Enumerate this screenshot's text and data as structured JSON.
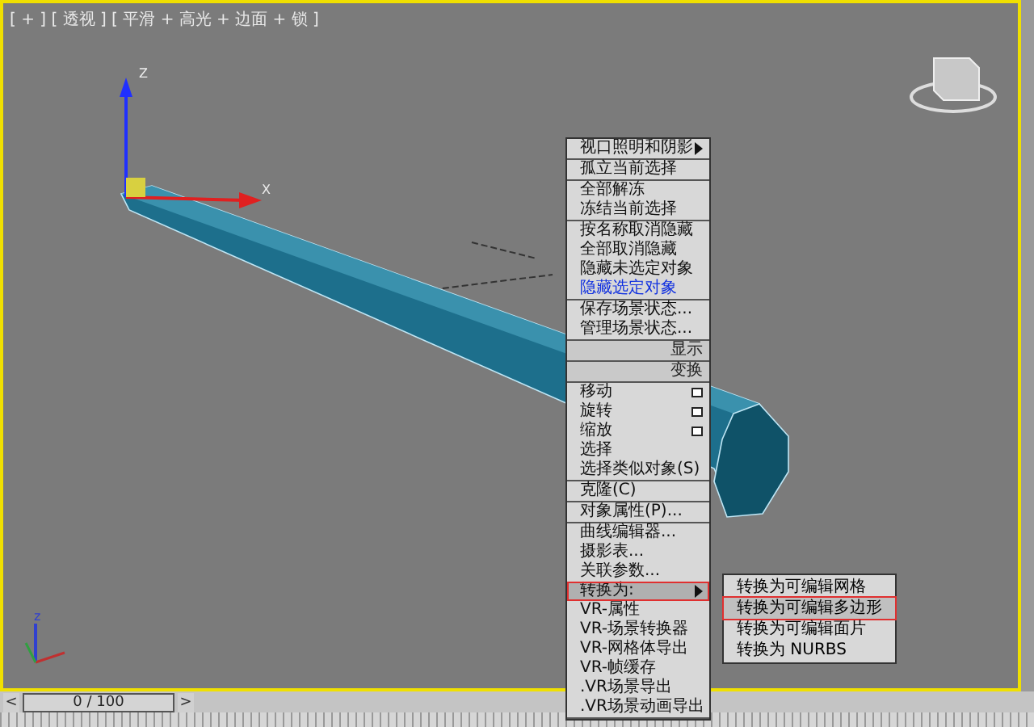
{
  "viewport": {
    "label": "[ + ] [ 透视 ] [ 平滑 + 高光 + 边面 + 锁 ]",
    "active": true,
    "gizmo_labels": {
      "z": "Z",
      "x": "X"
    },
    "tripod_label": "z"
  },
  "quad_menu": {
    "sections": [
      {
        "items": [
          {
            "label": "视口照明和阴影",
            "kind": "submenu",
            "highlighted": false,
            "selected": false
          }
        ]
      },
      {
        "items": [
          {
            "label": "孤立当前选择",
            "kind": "item",
            "highlighted": false,
            "selected": false
          }
        ]
      },
      {
        "items": [
          {
            "label": "全部解冻",
            "kind": "item",
            "highlighted": false,
            "selected": false
          },
          {
            "label": "冻结当前选择",
            "kind": "item",
            "highlighted": false,
            "selected": false
          }
        ]
      },
      {
        "items": [
          {
            "label": "按名称取消隐藏",
            "kind": "item",
            "highlighted": false,
            "selected": false
          },
          {
            "label": "全部取消隐藏",
            "kind": "item",
            "highlighted": false,
            "selected": false
          },
          {
            "label": "隐藏未选定对象",
            "kind": "item",
            "highlighted": false,
            "selected": false
          },
          {
            "label": "隐藏选定对象",
            "kind": "item",
            "highlighted": true,
            "selected": false
          }
        ]
      },
      {
        "items": [
          {
            "label": "保存场景状态...",
            "kind": "item",
            "highlighted": false,
            "selected": false
          },
          {
            "label": "管理场景状态...",
            "kind": "item",
            "highlighted": false,
            "selected": false
          }
        ]
      },
      {
        "items": [
          {
            "label": "显示",
            "kind": "header"
          }
        ]
      },
      {
        "items": [
          {
            "label": "变换",
            "kind": "header"
          }
        ]
      },
      {
        "items": [
          {
            "label": "移动",
            "kind": "options",
            "highlighted": false,
            "selected": false
          },
          {
            "label": "旋转",
            "kind": "options",
            "highlighted": false,
            "selected": false
          },
          {
            "label": "缩放",
            "kind": "options",
            "highlighted": false,
            "selected": false
          },
          {
            "label": "选择",
            "kind": "item",
            "highlighted": false,
            "selected": false
          },
          {
            "label": "选择类似对象(S)",
            "kind": "item",
            "highlighted": false,
            "selected": false
          }
        ]
      },
      {
        "items": [
          {
            "label": "克隆(C)",
            "kind": "item",
            "highlighted": false,
            "selected": false
          }
        ]
      },
      {
        "items": [
          {
            "label": "对象属性(P)...",
            "kind": "item",
            "highlighted": false,
            "selected": false
          }
        ]
      },
      {
        "items": [
          {
            "label": "曲线编辑器...",
            "kind": "item",
            "highlighted": false,
            "selected": false
          },
          {
            "label": "摄影表...",
            "kind": "item",
            "highlighted": false,
            "selected": false
          },
          {
            "label": "关联参数...",
            "kind": "item",
            "highlighted": false,
            "selected": false
          },
          {
            "label": "转换为:",
            "kind": "submenu",
            "highlighted": false,
            "selected": true
          },
          {
            "label": "VR-属性",
            "kind": "item",
            "highlighted": false,
            "selected": false
          },
          {
            "label": "VR-场景转换器",
            "kind": "item",
            "highlighted": false,
            "selected": false
          },
          {
            "label": "VR-网格体导出",
            "kind": "item",
            "highlighted": false,
            "selected": false
          },
          {
            "label": "VR-帧缓存",
            "kind": "item",
            "highlighted": false,
            "selected": false
          },
          {
            "label": ".VR场景导出",
            "kind": "item",
            "highlighted": false,
            "selected": false
          },
          {
            "label": ".VR场景动画导出",
            "kind": "item",
            "highlighted": false,
            "selected": false
          }
        ]
      }
    ]
  },
  "submenu": {
    "items": [
      {
        "label": "转换为可编辑网格",
        "selected": false
      },
      {
        "label": "转换为可编辑多边形",
        "selected": true
      },
      {
        "label": "转换为可编辑面片",
        "selected": false
      },
      {
        "label": "转换为 NURBS",
        "selected": false
      }
    ]
  },
  "time_slider": {
    "prev": "<",
    "position": "0 / 100",
    "next": ">",
    "level": 0
  }
}
